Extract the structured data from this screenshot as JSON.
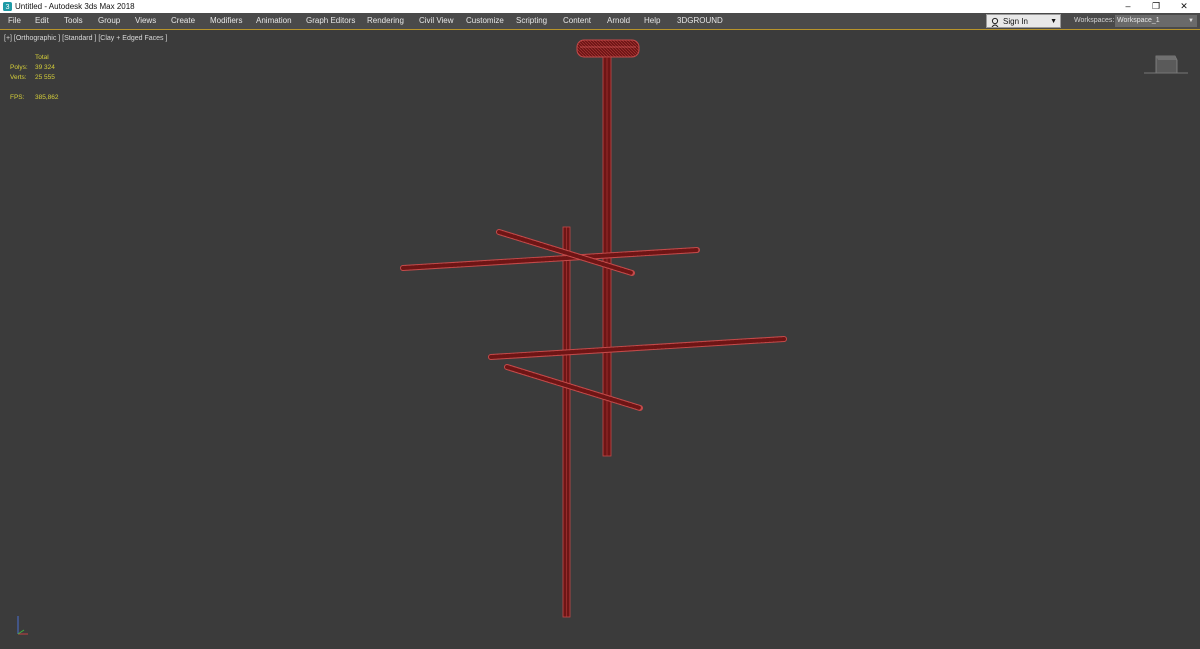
{
  "window": {
    "title": "Untitled - Autodesk 3ds Max 2018",
    "minimize_glyph": "–",
    "restore_glyph": "❐",
    "close_glyph": "✕"
  },
  "menu": {
    "items": [
      "File",
      "Edit",
      "Tools",
      "Group",
      "Views",
      "Create",
      "Modifiers",
      "Animation",
      "Graph Editors",
      "Rendering",
      "Civil View",
      "Customize",
      "Scripting",
      "Content",
      "Arnold",
      "Help",
      "3DGROUND"
    ]
  },
  "account": {
    "signin_label": "Sign In",
    "workspaces_label": "Workspaces:",
    "workspace_value": "Workspace_1"
  },
  "viewport": {
    "label": "[+] [Orthographic ] [Standard ] [Clay + Edged Faces ]",
    "stats": {
      "total_label": "Total",
      "polys_label": "Polys:",
      "polys_value": "39 324",
      "verts_label": "Verts:",
      "verts_value": "25 555",
      "fps_label": "FPS:",
      "fps_value": "385,862"
    },
    "object_color": "#7a1818",
    "edge_color": "#c44a4a",
    "background_color": "#3b3b3b"
  }
}
